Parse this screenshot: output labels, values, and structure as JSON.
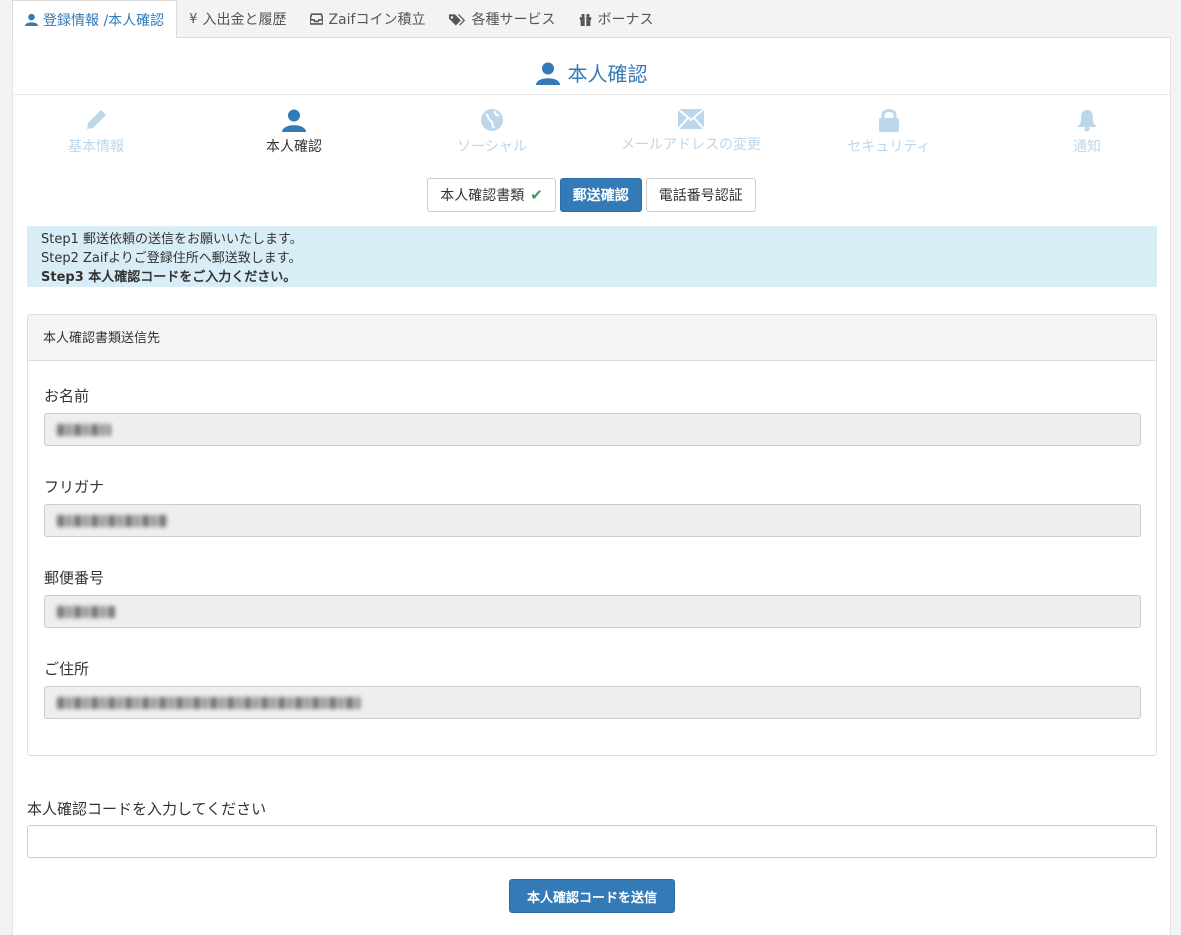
{
  "top_tabs": [
    {
      "label": "登録情報 /本人確認",
      "icon": "user-icon",
      "active": true
    },
    {
      "label": "入出金と履歴",
      "icon": "yen-icon",
      "active": false
    },
    {
      "label": "Zaifコイン積立",
      "icon": "inbox-icon",
      "active": false
    },
    {
      "label": "各種サービス",
      "icon": "tags-icon",
      "active": false
    },
    {
      "label": "ボーナス",
      "icon": "gift-icon",
      "active": false
    }
  ],
  "page": {
    "title": "本人確認",
    "title_icon": "user-icon"
  },
  "subnav": [
    {
      "label": "基本情報",
      "icon": "pencil-icon",
      "active": false
    },
    {
      "label": "本人確認",
      "icon": "user-icon",
      "active": true
    },
    {
      "label": "ソーシャル",
      "icon": "globe-icon",
      "active": false
    },
    {
      "label": "メールアドレスの変更",
      "icon": "envelope-icon",
      "active": false
    },
    {
      "label": "セキュリティ",
      "icon": "lock-icon",
      "active": false
    },
    {
      "label": "通知",
      "icon": "bell-icon",
      "active": false
    }
  ],
  "step_buttons": [
    {
      "label": "本人確認書類",
      "check": "✔",
      "active": false
    },
    {
      "label": "郵送確認",
      "active": true
    },
    {
      "label": "電話番号認証",
      "active": false
    }
  ],
  "info": {
    "step1": "Step1 郵送依頼の送信をお願いいたします。",
    "step2": "Step2 Zaifよりご登録住所へ郵送致します。",
    "step3": "Step3 本人確認コードをご入力ください。"
  },
  "card": {
    "title": "本人確認書類送信先",
    "fields": [
      {
        "label": "お名前"
      },
      {
        "label": "フリガナ"
      },
      {
        "label": "郵便番号"
      },
      {
        "label": "ご住所"
      }
    ]
  },
  "code": {
    "label": "本人確認コードを入力してください",
    "value": "",
    "submit_label": "本人確認コードを送信"
  },
  "colors": {
    "accent": "#337ab7",
    "info_bg": "#d9edf7",
    "inactive_nav": "#bcd6ea",
    "check": "#3c9a5f"
  }
}
